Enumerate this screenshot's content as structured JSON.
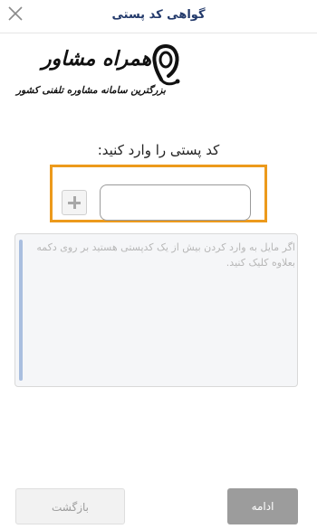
{
  "header": {
    "title": "گواهی کد پستی"
  },
  "logo": {
    "brand": "همراه مشاور",
    "tagline": "بزرگترین سامانه مشاوره تلفنی کشور"
  },
  "form": {
    "prompt": "کد پستی را وارد کنید:",
    "postal_code_value": "",
    "description_placeholder": "اگر مایل به وارد کردن بیش از یک کدپستی هستید بر روی دکمه بعلاوه کلیک کنید."
  },
  "footer": {
    "back_label": "بازگشت",
    "continue_label": "ادامه"
  },
  "colors": {
    "highlight_border": "#ec9a1c",
    "title_text": "#233a6b",
    "continue_button": "#9c9c9c"
  }
}
